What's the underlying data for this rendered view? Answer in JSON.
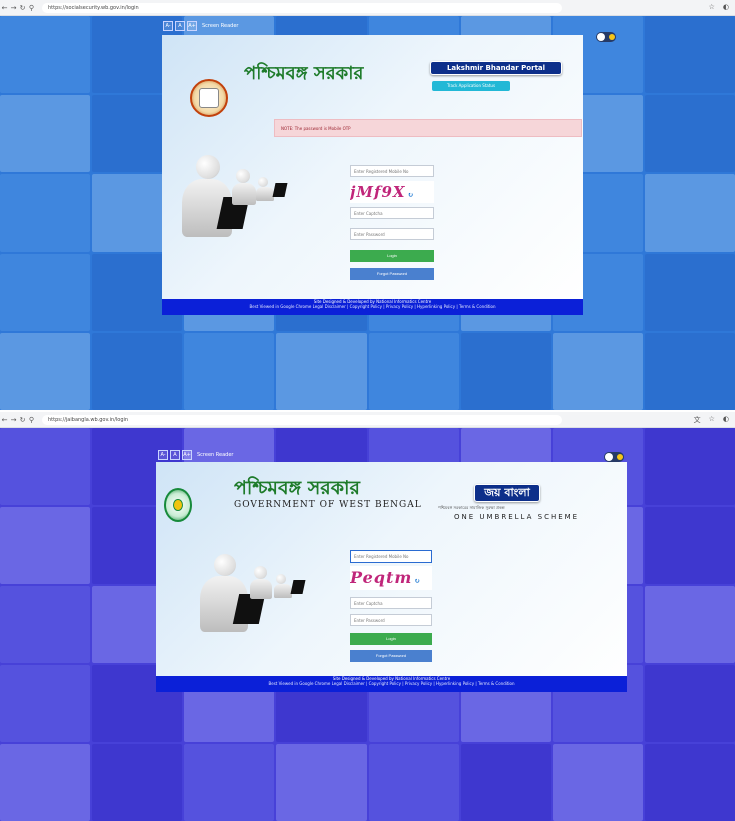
{
  "screenshot_top": {
    "url": "https://socialsecurity.wb.gov.in/login",
    "accessibility": {
      "buttons": [
        "A-",
        "A",
        "A+"
      ],
      "screen_reader": "Screen Reader"
    },
    "title_bn": "পশ্চিমবঙ্গ সরকার",
    "portal_badge": "Lakshmir Bhandar Portal",
    "track_button": "Track Application Status",
    "note": "NOTE: The password is Mobile OTP",
    "form": {
      "user_placeholder": "Enter Registered Mobile No",
      "captcha_text": "jMf9X",
      "captcha_placeholder": "Enter Captcha",
      "password_placeholder": "Enter Password",
      "login": "Login",
      "forgot": "Forgot Password"
    },
    "footer_line1": "Site Designed & Developed by National Informatics Centre",
    "footer_line2": "Best Viewed in Google Chrome  Legal Disclaimer | Copyright Policy | Privacy Policy | Hyperlinking Policy | Terms & Condition"
  },
  "screenshot_bottom": {
    "url": "https://jaibangla.wb.gov.in/login",
    "accessibility": {
      "buttons": [
        "A-",
        "A",
        "A+"
      ],
      "screen_reader": "Screen Reader"
    },
    "title_bn": "পশ্চিমবঙ্গ সরকার",
    "title_en": "GOVERNMENT OF WEST BENGAL",
    "scheme_badge": "জয় বাংলা",
    "scheme_bn": "পশ্চিমবঙ্গ সরকারের সামাজিক সুরক্ষা প্রকল্প",
    "scheme_en": "ONE UMBRELLA SCHEME",
    "form": {
      "user_placeholder": "Enter Registered Mobile No",
      "captcha_text": "Peqtm",
      "captcha_placeholder": "Enter Captcha",
      "password_placeholder": "Enter Password",
      "login": "Login",
      "forgot": "Forgot Password"
    },
    "footer_line1": "Site Designed & Developed by National Informatics Centre",
    "footer_line2": "Best Viewed in Google Chrome  Legal Disclaimer | Copyright Policy | Privacy Policy | Hyperlinking Policy | Terms & Condition"
  }
}
